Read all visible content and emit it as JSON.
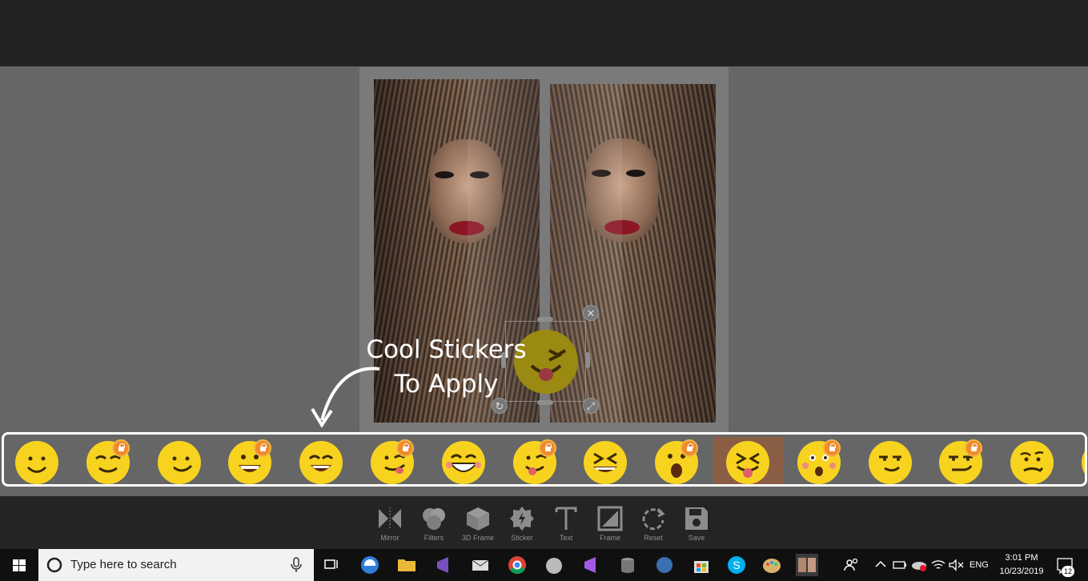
{
  "annotation": {
    "line1": "Cool Stickers",
    "line2": "To Apply"
  },
  "stickers": [
    {
      "face": "smile",
      "locked": false,
      "selected": false
    },
    {
      "face": "wink-smile",
      "locked": true,
      "selected": false
    },
    {
      "face": "smile-side",
      "locked": false,
      "selected": false
    },
    {
      "face": "big-grin",
      "locked": true,
      "selected": false
    },
    {
      "face": "grin",
      "locked": false,
      "selected": false
    },
    {
      "face": "smirk-tongue",
      "locked": true,
      "selected": false
    },
    {
      "face": "teeth-grin",
      "locked": false,
      "selected": false
    },
    {
      "face": "tongue-smile",
      "locked": true,
      "selected": false
    },
    {
      "face": "squint-laugh",
      "locked": false,
      "selected": false
    },
    {
      "face": "surprised",
      "locked": true,
      "selected": false
    },
    {
      "face": "squint-tongue",
      "locked": false,
      "selected": true
    },
    {
      "face": "shocked",
      "locked": true,
      "selected": false
    },
    {
      "face": "unamused-smile",
      "locked": false,
      "selected": false
    },
    {
      "face": "smirk",
      "locked": true,
      "selected": false
    },
    {
      "face": "confused",
      "locked": false,
      "selected": false
    }
  ],
  "toolbar": {
    "mirror": "Mirror",
    "filters": "Filters",
    "frame3d": "3D Frame",
    "sticker": "Sticker",
    "text": "Text",
    "frame": "Frame",
    "reset": "Reset",
    "save": "Save"
  },
  "taskbar": {
    "search_placeholder": "Type here to search",
    "language": "ENG",
    "time": "3:01 PM",
    "date": "10/23/2019",
    "notifications": "12"
  },
  "colors": {
    "sticker_yellow": "#f7d320",
    "lock_orange": "#f08a2b",
    "selected_bg": "#8a5e45",
    "strip_border": "#ffffff"
  }
}
